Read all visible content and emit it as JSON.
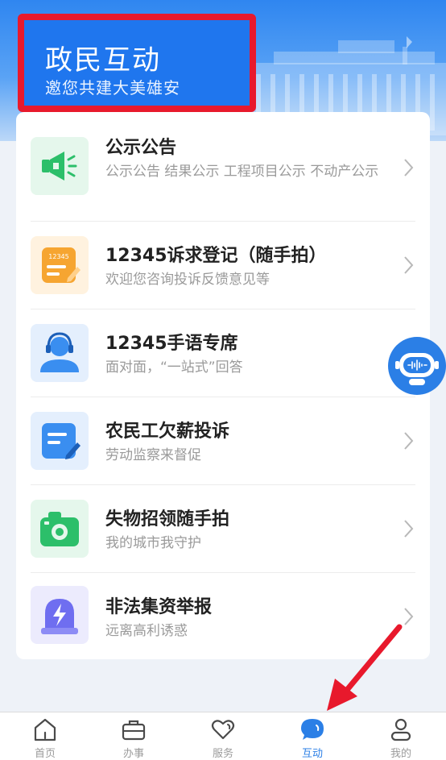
{
  "header": {
    "title": "政民互动",
    "subtitle": "邀您共建大美雄安"
  },
  "items": [
    {
      "title": "公示公告",
      "desc": "公示公告 结果公示 工程项目公示 不动产公示",
      "icon": "megaphone-icon",
      "color": "#2cbf6a"
    },
    {
      "title": "12345诉求登记（随手拍）",
      "desc": "欢迎您咨询投诉反馈意见等",
      "icon": "note-12345-icon",
      "color": "#f6a531"
    },
    {
      "title": "12345手语专席",
      "desc": "面对面，“一站式”回答",
      "icon": "headset-agent-icon",
      "color": "#3a8ef0"
    },
    {
      "title": "农民工欠薪投诉",
      "desc": "劳动监察来督促",
      "icon": "document-edit-icon",
      "color": "#3a8ef0"
    },
    {
      "title": "失物招领随手拍",
      "desc": "我的城市我守护",
      "icon": "camera-icon",
      "color": "#2cbf6a"
    },
    {
      "title": "非法集资举报",
      "desc": "远离高利诱惑",
      "icon": "alarm-icon",
      "color": "#6f6ef0"
    }
  ],
  "icon_note_text": "12345",
  "tabs": [
    {
      "label": "首页",
      "icon": "home-icon",
      "active": false
    },
    {
      "label": "办事",
      "icon": "briefcase-icon",
      "active": false
    },
    {
      "label": "服务",
      "icon": "heart-icon",
      "active": false
    },
    {
      "label": "互动",
      "icon": "chat-bubble-icon",
      "active": true
    },
    {
      "label": "我的",
      "icon": "person-icon",
      "active": false
    }
  ],
  "colors": {
    "primary": "#2b7fe6",
    "highlight": "#e8192c",
    "text_muted": "#9a9a9a"
  }
}
